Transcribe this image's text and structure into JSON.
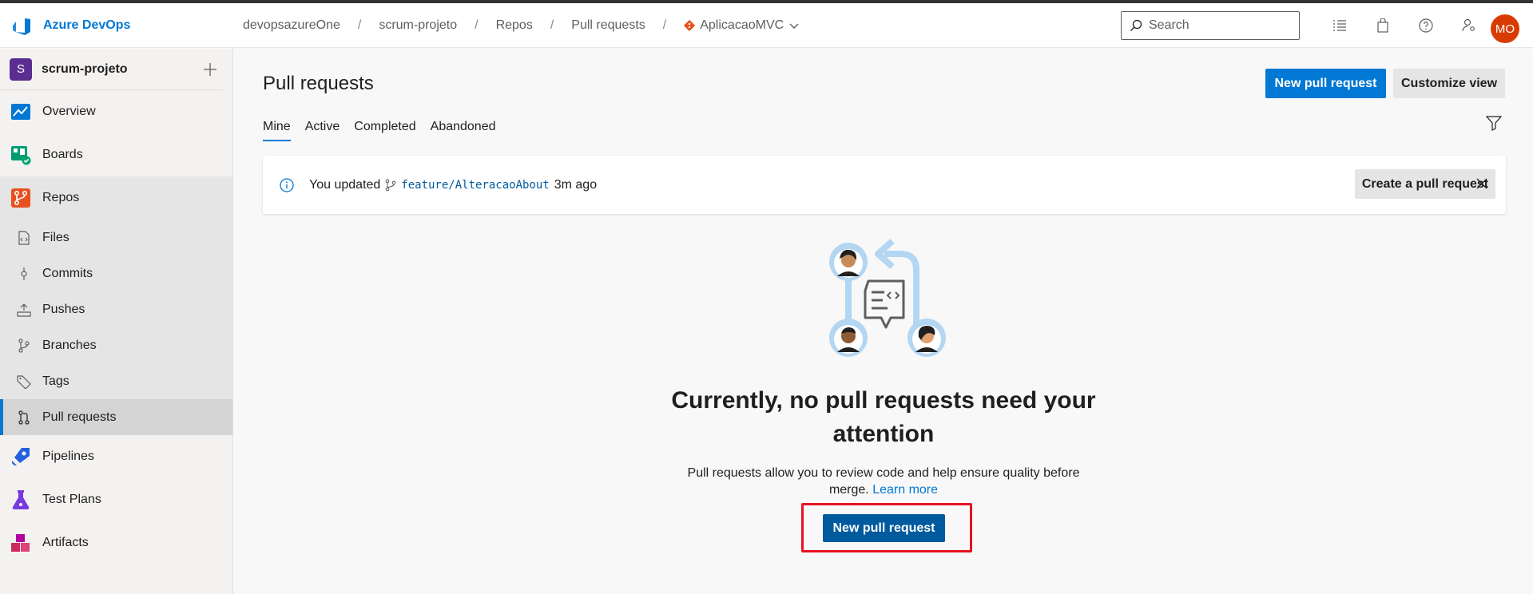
{
  "app": {
    "name": "Azure DevOps"
  },
  "breadcrumbs": [
    "devopsazureOne",
    "scrum-projeto",
    "Repos",
    "Pull requests"
  ],
  "repo_selector": {
    "label": "AplicacaoMVC"
  },
  "search": {
    "placeholder": "Search"
  },
  "user": {
    "initials": "MO"
  },
  "project": {
    "initial": "S",
    "name": "scrum-projeto"
  },
  "nav": {
    "overview": "Overview",
    "boards": "Boards",
    "repos": "Repos",
    "repos_sub": [
      "Files",
      "Commits",
      "Pushes",
      "Branches",
      "Tags",
      "Pull requests"
    ],
    "pipelines": "Pipelines",
    "test_plans": "Test Plans",
    "artifacts": "Artifacts"
  },
  "page": {
    "title": "Pull requests",
    "new_pr_button": "New pull request",
    "customize_button": "Customize view",
    "tabs": [
      "Mine",
      "Active",
      "Completed",
      "Abandoned"
    ],
    "active_tab": "Mine"
  },
  "banner": {
    "prefix": "You updated",
    "branch": "feature/AlteracaoAbout",
    "suffix": "3m ago",
    "button": "Create a pull request"
  },
  "empty_state": {
    "title": "Currently, no pull requests need your attention",
    "description": "Pull requests allow you to review code and help ensure quality before merge.",
    "learn_more": "Learn more",
    "button": "New pull request"
  },
  "colors": {
    "accent": "#0078d4",
    "highlight": "#e81123",
    "avatar": "#d83b01",
    "project_badge": "#5c2d91"
  }
}
